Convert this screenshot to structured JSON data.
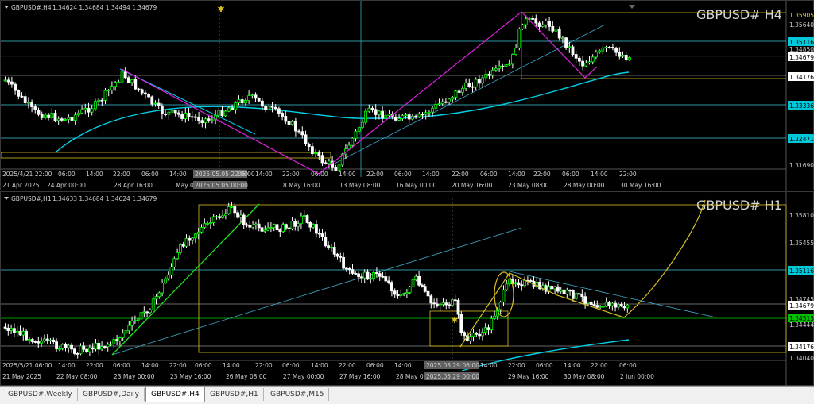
{
  "charts": [
    {
      "symbol_label": "GBPUSD#,H4",
      "ohlc": "1.34624 1.34684 1.34494 1.34679",
      "watermark": "GBPUSD# H4",
      "price_labels": [
        {
          "text": "1.35905",
          "kind": "yellow"
        },
        {
          "text": "1.35640",
          "kind": "plain"
        },
        {
          "text": "1.35116",
          "kind": "cyan"
        },
        {
          "text": "1.34850",
          "kind": "plain"
        },
        {
          "text": "1.34679",
          "kind": "white"
        },
        {
          "text": "1.34176",
          "kind": "white"
        },
        {
          "text": "1.33336",
          "kind": "cyan"
        },
        {
          "text": "1.32471",
          "kind": "cyan"
        },
        {
          "text": "1.31690",
          "kind": "plain"
        }
      ],
      "time_top": [
        "2025/4/21 22:00",
        "06:00",
        "14:00",
        "22:00",
        "06:00",
        "14:00",
        "2025.05.05 22:00",
        "06:00",
        "14:00",
        "22:00",
        "06:00",
        "14:00",
        "22:00",
        "06:00",
        "14:00",
        "22:00",
        "06:00",
        "14:00",
        "22:00",
        "06:00",
        "14:00",
        "22:00"
      ],
      "time_bottom": [
        "21 Apr 2025",
        "24 Apr 00:00",
        "28 Apr 16:00",
        "1 May 0",
        "2025.05.05 00:00",
        "8 May 16:00",
        "13 May 08:00",
        "16 May 00:00",
        "20 May 16:00",
        "23 May 08:00",
        "28 May 00:00",
        "30 May 16:00"
      ]
    },
    {
      "symbol_label": "GBPUSD#,H1",
      "ohlc": "1.34633 1.34684 1.34624 1.34679",
      "watermark": "GBPUSD# H1",
      "price_labels": [
        {
          "text": "1.35810",
          "kind": "plain"
        },
        {
          "text": "1.35455",
          "kind": "plain"
        },
        {
          "text": "1.35116",
          "kind": "cyan"
        },
        {
          "text": "1.34745",
          "kind": "plain"
        },
        {
          "text": "1.34679",
          "kind": "white"
        },
        {
          "text": "1.34515",
          "kind": "green"
        },
        {
          "text": "1.34444",
          "kind": "plain"
        },
        {
          "text": "1.34176",
          "kind": "white"
        },
        {
          "text": "1.34040",
          "kind": "plain"
        }
      ],
      "time_top": [
        "2025/5/21 06:00",
        "14:00",
        "22:00",
        "06:00",
        "14:00",
        "22:00",
        "06:00",
        "14:00",
        "22:00",
        "06:00",
        "14:00",
        "22:00",
        "06:00",
        "14:00",
        "2025.05.29 06:00",
        "14:00",
        "22:00",
        "06:00",
        "14:00",
        "22:00",
        "06:00"
      ],
      "time_bottom": [
        "21 May 2025",
        "22 May 08:00",
        "23 May 00:00",
        "23 May 16:00",
        "26 May 08:00",
        "27 May 00:00",
        "27 May 16:00",
        "28 May 08",
        "2025.05.29 00:00",
        "29 May 16:00",
        "30 May 08:00",
        "2 Jun 00:00"
      ]
    }
  ],
  "tabs": [
    "GBPUSD#,Weekly",
    "GBPUSD#,Daily",
    "GBPUSD#,H4",
    "GBPUSD#,H1",
    "GBPUSD#,M15"
  ],
  "active_tab": "GBPUSD#,H4",
  "colors": {
    "candle": "#ffffff",
    "bull": "#00ff00",
    "ma": "#00d0e8",
    "level": "#40c8d8",
    "yellow": "#d8c020",
    "magenta": "#e020e0",
    "trend": "#40a8c8",
    "green": "#00cc00",
    "axis_bg": "#000000",
    "price_text": "#c0c0c0"
  }
}
